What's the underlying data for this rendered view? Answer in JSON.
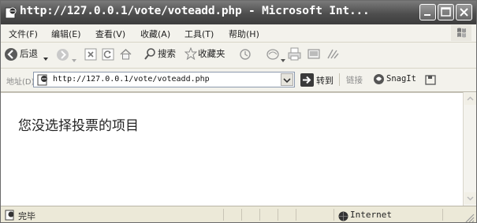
{
  "window": {
    "title": "http://127.0.0.1/vote/voteadd.php - Microsoft Int..."
  },
  "menu": {
    "items": [
      {
        "label": "文件(F)"
      },
      {
        "label": "编辑(E)"
      },
      {
        "label": "查看(V)"
      },
      {
        "label": "收藏(A)"
      },
      {
        "label": "工具(T)"
      },
      {
        "label": "帮助(H)"
      }
    ]
  },
  "toolbar": {
    "back_label": "后退",
    "search_label": "搜索",
    "favorites_label": "收藏夹"
  },
  "address": {
    "label": "地址(D)",
    "url": "http://127.0.0.1/vote/voteadd.php",
    "go_label": "转到",
    "links_label": "链接",
    "snagit_label": "SnagIt"
  },
  "content": {
    "message": "您没选择投票的项目"
  },
  "status": {
    "text": "完毕",
    "zone": "Internet"
  },
  "colors": {
    "titlebar": "#4e4e4e",
    "chrome": "#ece9d8",
    "go_arrow": "#3a3a3a"
  }
}
